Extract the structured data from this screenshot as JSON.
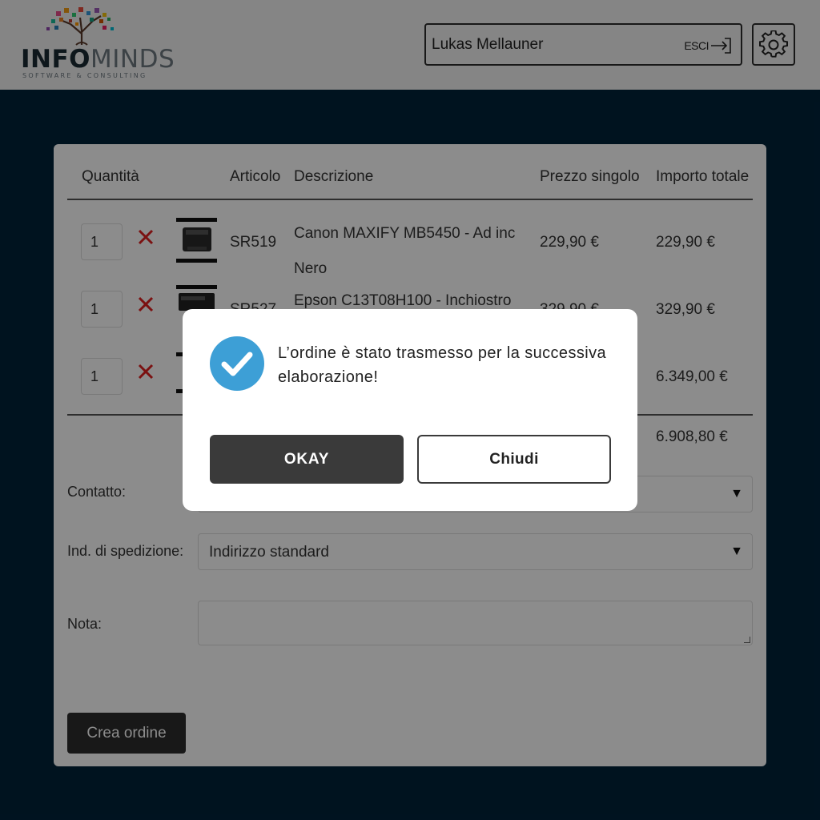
{
  "header": {
    "logo_left": "INFO",
    "logo_right": "MINDS",
    "logo_tagline": "SOFTWARE & CONSULTING",
    "user_name": "Lukas Mellauner",
    "logout_label": "ESCI",
    "logout_icon": "logout-arrow-icon",
    "settings_icon": "gear-icon"
  },
  "cart": {
    "columns": [
      "Quantità",
      "Articolo",
      "Descrizione",
      "Prezzo singolo",
      "Importo totale"
    ],
    "rows": [
      {
        "qty": "1",
        "article": "SR519",
        "desc_line1": "Canon MAXIFY MB5450 - Ad inc",
        "desc_line2": "Nero",
        "price": "229,90 €",
        "total": "229,90 €"
      },
      {
        "qty": "1",
        "article": "SR527",
        "desc_line1": "Epson C13T08H100 - Inchiostro",
        "desc_line2": "",
        "price": "329,90 €",
        "total": "329,90 €"
      },
      {
        "qty": "1",
        "article": "",
        "desc_line1": "",
        "desc_line2": "",
        "price": "",
        "total": "6.349,00 €"
      }
    ],
    "grand_total": "6.908,80 €"
  },
  "form": {
    "contact_label": "Contatto:",
    "shipping_label": "Ind. di spedizione:",
    "shipping_value": "Indirizzo standard",
    "note_label": "Nota:",
    "create_button": "Crea ordine"
  },
  "modal": {
    "message": "L’ordine è stato trasmesso per la successiva elaborazione!",
    "ok_label": "OKAY",
    "close_label": "Chiudi",
    "check_color": "#3d9fd6"
  }
}
